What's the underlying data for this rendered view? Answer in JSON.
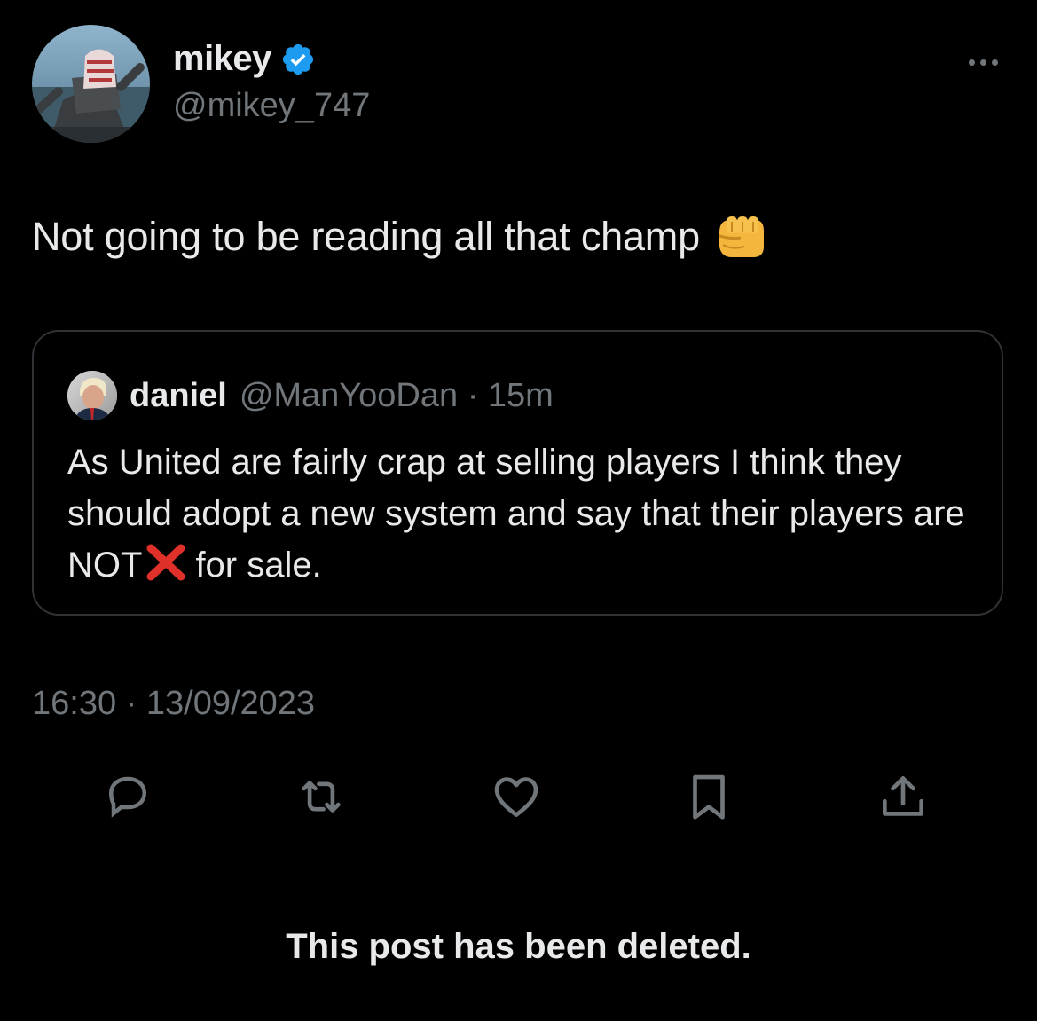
{
  "author": {
    "display_name": "mikey",
    "handle": "@mikey_747",
    "verified_icon": "verified-badge-icon"
  },
  "tweet": {
    "text": "Not going to be reading all that champ",
    "emoji": "oncoming-fist-emoji"
  },
  "quote": {
    "name": "daniel",
    "meta": "@ManYooDan · 15m",
    "body_before": "As United are fairly crap at selling players I think they should adopt a new system and say that their players are NOT",
    "emoji": "cross-mark-emoji",
    "body_after": "for sale."
  },
  "timestamp": "16:30 · 13/09/2023",
  "actions": [
    "reply-icon",
    "retweet-icon",
    "like-icon",
    "bookmark-icon",
    "share-icon"
  ],
  "notice": "This post has been deleted.",
  "colors": {
    "background": "#000000",
    "text": "#e7e9ea",
    "secondary": "#71767b",
    "border": "#2f3336",
    "verified": "#1d9bf0"
  }
}
